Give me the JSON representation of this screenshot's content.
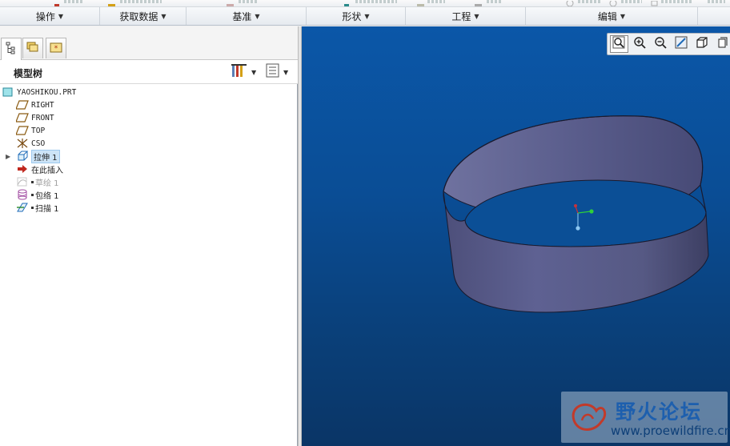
{
  "ribbon_groups": [
    {
      "label": "操作"
    },
    {
      "label": "获取数据"
    },
    {
      "label": "基准"
    },
    {
      "label": "形状"
    },
    {
      "label": "工程"
    },
    {
      "label": "编辑"
    }
  ],
  "model_tree": {
    "title": "模型树",
    "items": [
      {
        "label": "YAOSHIKOU.PRT",
        "icon": "part-icon"
      },
      {
        "label": "RIGHT",
        "icon": "datum-plane-icon"
      },
      {
        "label": "FRONT",
        "icon": "datum-plane-icon"
      },
      {
        "label": "TOP",
        "icon": "datum-plane-icon"
      },
      {
        "label": "CSO",
        "icon": "coordinate-system-icon"
      },
      {
        "label": "拉伸 1",
        "icon": "extrude-icon"
      },
      {
        "label": "在此插入",
        "icon": "insert-here-arrow-icon"
      },
      {
        "label": "草绘 1",
        "icon": "sketch-icon"
      },
      {
        "label": "包络 1",
        "icon": "wrap-icon"
      },
      {
        "label": "扫描 1",
        "icon": "sweep-icon"
      }
    ]
  },
  "view_toolbar": [
    "zoom-refit-icon",
    "zoom-in-icon",
    "zoom-out-icon",
    "repaint-icon",
    "display-style-icon",
    "saved-views-icon"
  ],
  "watermark": {
    "title": "野火论坛",
    "url": "www.proewildfire.cn"
  },
  "colors": {
    "viewport_top": "#0b57a8",
    "viewport_bottom": "#0a3566",
    "model_surface": "#5a5d8c",
    "selection": "#cce4f7"
  }
}
